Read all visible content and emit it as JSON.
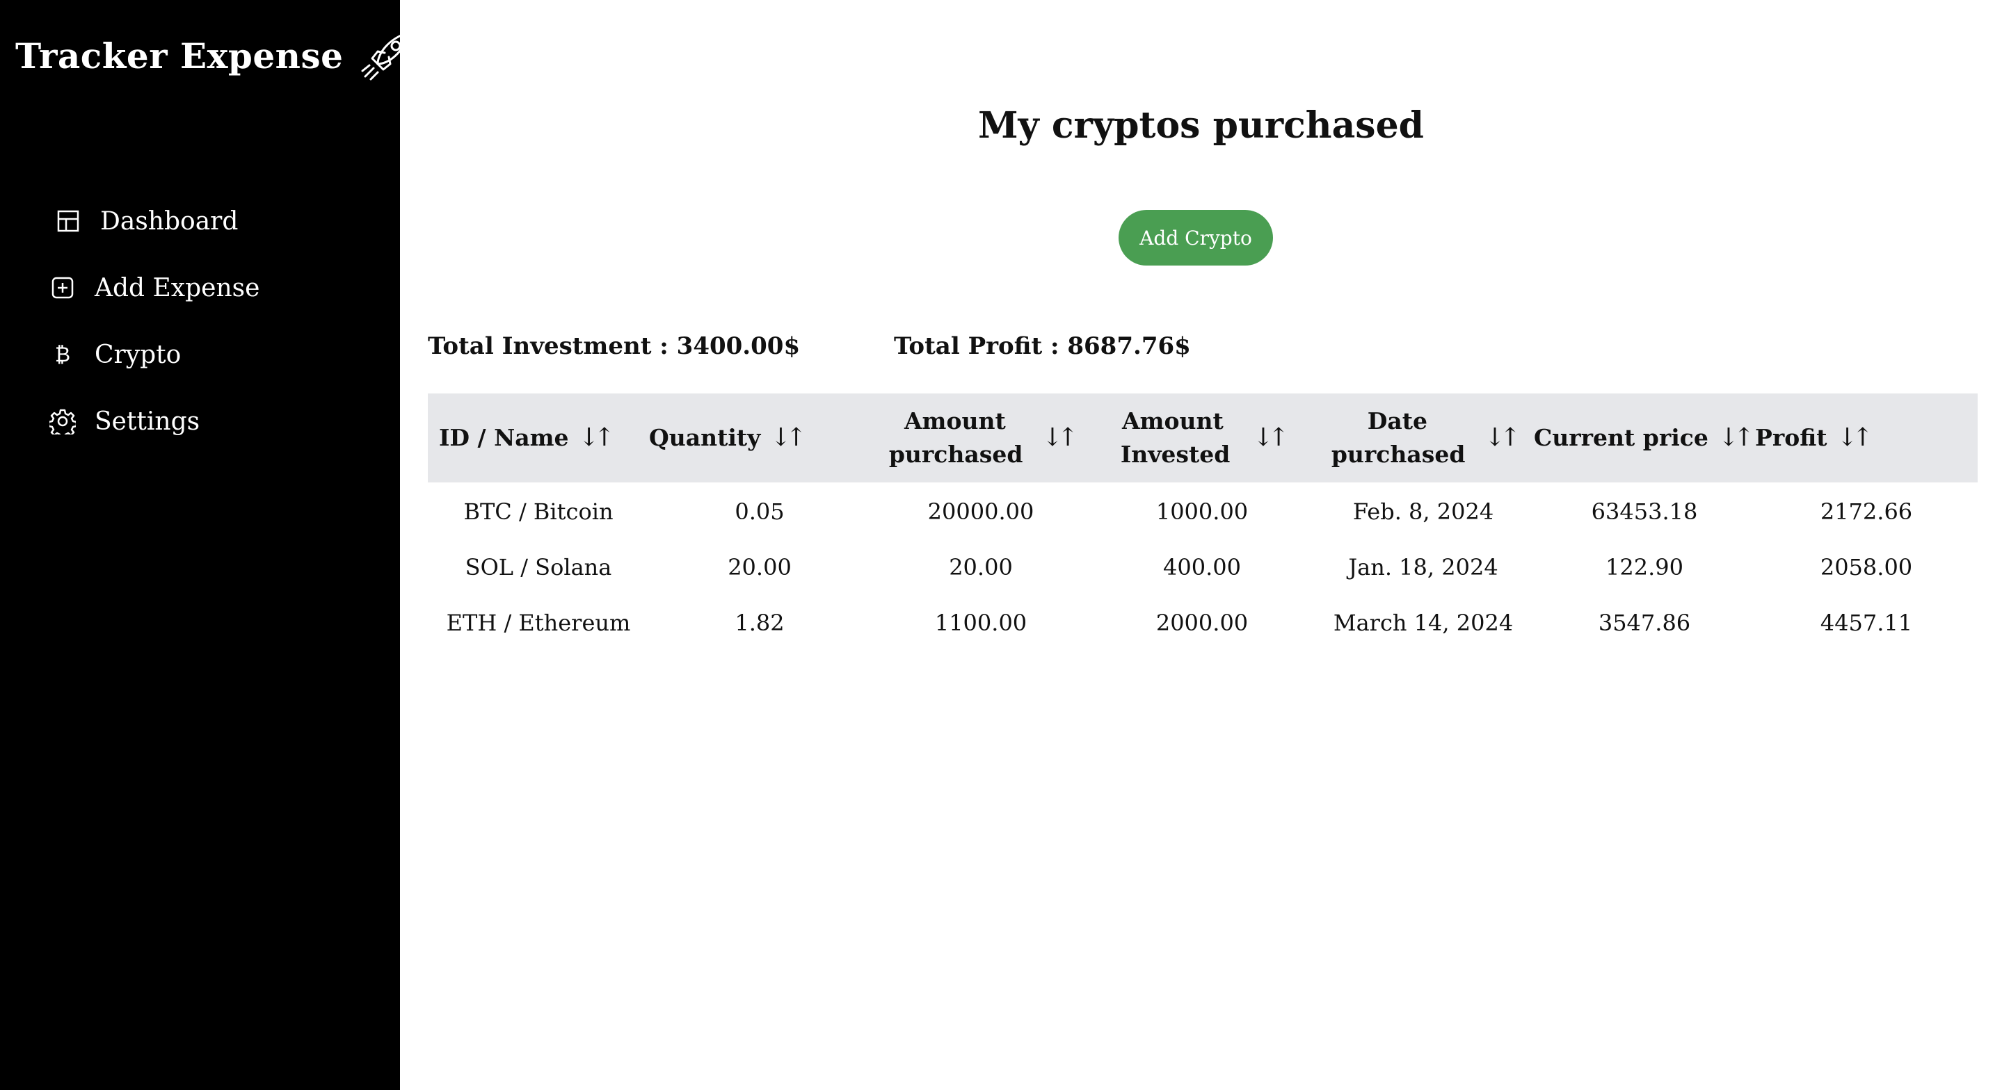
{
  "sidebar": {
    "brand": "Tracker Expense",
    "brand_icon": "rocket-icon",
    "items": [
      {
        "label": "Dashboard",
        "icon": "dashboard-grid-icon"
      },
      {
        "label": "Add Expense",
        "icon": "plus-square-icon"
      },
      {
        "label": "Crypto",
        "icon": "bitcoin-icon"
      },
      {
        "label": "Settings",
        "icon": "gear-icon"
      }
    ]
  },
  "main": {
    "title": "My cryptos purchased",
    "add_button": "Add Crypto",
    "accent_color": "#4a9e52",
    "totals": {
      "investment": "Total Investment : 3400.00$",
      "profit": "Total Profit : 8687.76$"
    },
    "table": {
      "columns": [
        "ID / Name",
        "Quantity",
        "Amount purchased",
        "Amount Invested",
        "Date purchased",
        "Current price",
        "Profit"
      ],
      "rows": [
        [
          "BTC / Bitcoin",
          "0.05",
          "20000.00",
          "1000.00",
          "Feb. 8, 2024",
          "63453.18",
          "2172.66"
        ],
        [
          "SOL / Solana",
          "20.00",
          "20.00",
          "400.00",
          "Jan. 18, 2024",
          "122.90",
          "2058.00"
        ],
        [
          "ETH / Ethereum",
          "1.82",
          "1100.00",
          "2000.00",
          "March 14, 2024",
          "3547.86",
          "4457.11"
        ]
      ]
    }
  }
}
